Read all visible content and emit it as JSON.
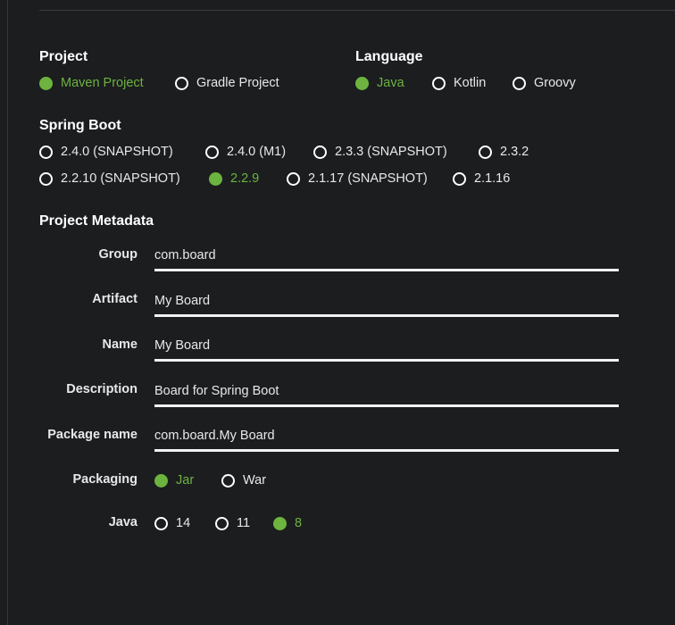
{
  "project": {
    "title": "Project",
    "options": [
      {
        "label": "Maven Project",
        "selected": true
      },
      {
        "label": "Gradle Project",
        "selected": false
      }
    ]
  },
  "language": {
    "title": "Language",
    "options": [
      {
        "label": "Java",
        "selected": true
      },
      {
        "label": "Kotlin",
        "selected": false
      },
      {
        "label": "Groovy",
        "selected": false
      }
    ]
  },
  "spring_boot": {
    "title": "Spring Boot",
    "row1": [
      {
        "label": "2.4.0 (SNAPSHOT)",
        "selected": false
      },
      {
        "label": "2.4.0 (M1)",
        "selected": false
      },
      {
        "label": "2.3.3 (SNAPSHOT)",
        "selected": false
      },
      {
        "label": "2.3.2",
        "selected": false
      }
    ],
    "row2": [
      {
        "label": "2.2.10 (SNAPSHOT)",
        "selected": false
      },
      {
        "label": "2.2.9",
        "selected": true
      },
      {
        "label": "2.1.17 (SNAPSHOT)",
        "selected": false
      },
      {
        "label": "2.1.16",
        "selected": false
      }
    ]
  },
  "metadata": {
    "title": "Project Metadata",
    "group": {
      "label": "Group",
      "value": "com.board"
    },
    "artifact": {
      "label": "Artifact",
      "value": "My Board"
    },
    "name": {
      "label": "Name",
      "value": "My Board"
    },
    "description": {
      "label": "Description",
      "value": "Board for Spring Boot"
    },
    "package_name": {
      "label": "Package name",
      "value": "com.board.My Board"
    },
    "packaging": {
      "label": "Packaging",
      "options": [
        {
          "label": "Jar",
          "selected": true
        },
        {
          "label": "War",
          "selected": false
        }
      ]
    },
    "java": {
      "label": "Java",
      "options": [
        {
          "label": "14",
          "selected": false
        },
        {
          "label": "11",
          "selected": false
        },
        {
          "label": "8",
          "selected": true
        }
      ]
    }
  },
  "colors": {
    "accent": "#6db33f",
    "background": "#1b1d1f",
    "text": "#e8e8e8"
  }
}
